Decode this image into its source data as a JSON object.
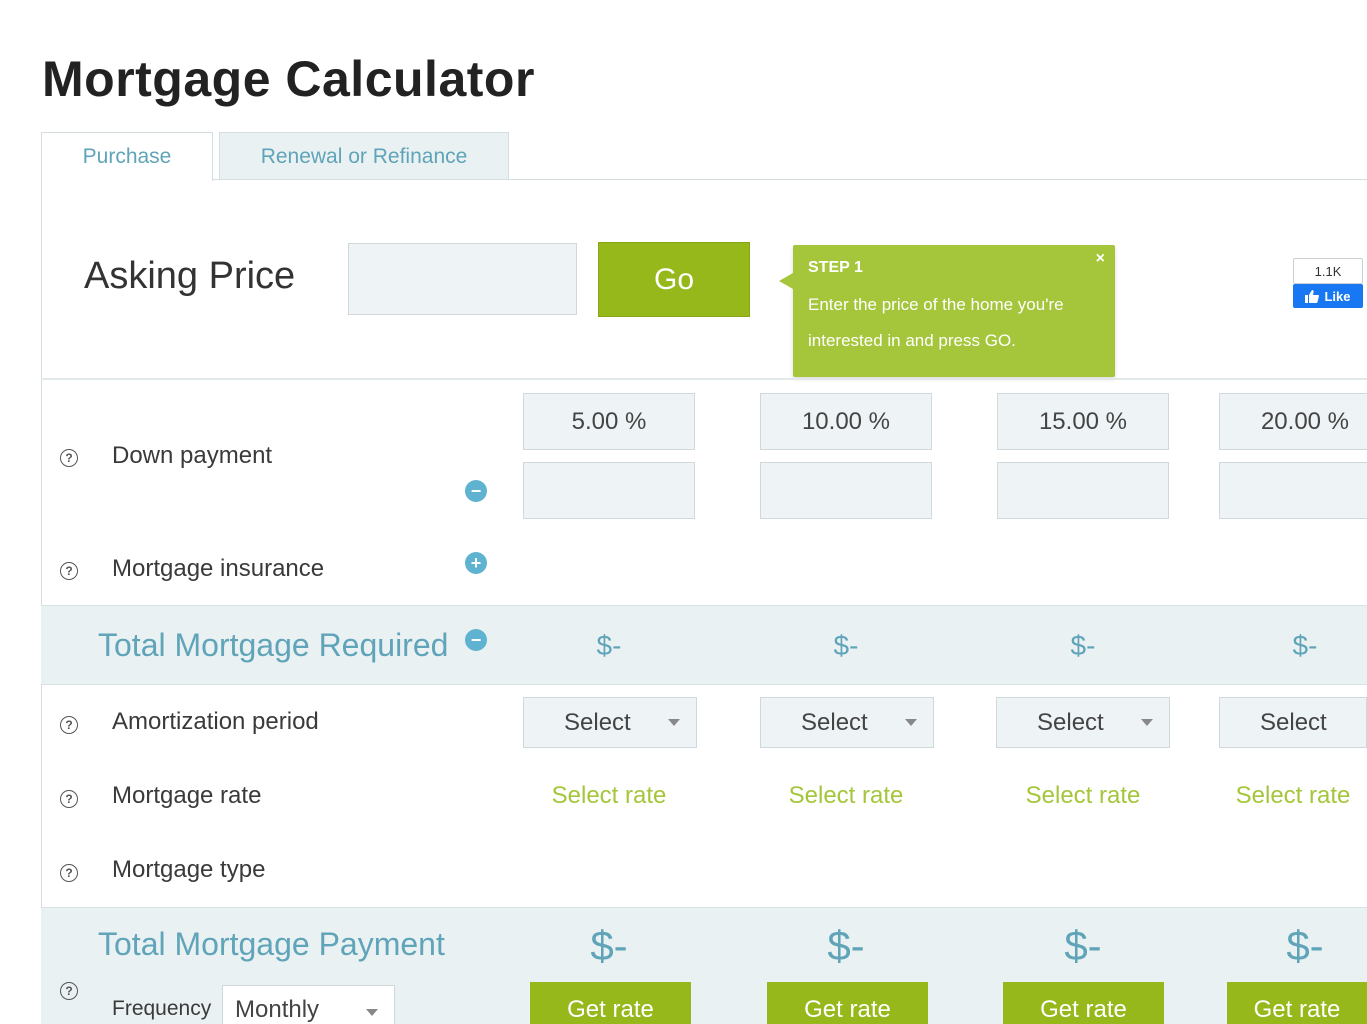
{
  "page": {
    "title": "Mortgage Calculator"
  },
  "tabs": [
    {
      "label": "Purchase",
      "active": true
    },
    {
      "label": "Renewal or Refinance",
      "active": false
    }
  ],
  "asking_price": {
    "label": "Asking Price",
    "value": "",
    "go_label": "Go"
  },
  "tooltip": {
    "title": "STEP 1",
    "text": "Enter the price of the home you're interested in and press GO.",
    "close": "×"
  },
  "facebook": {
    "count": "1.1K",
    "like_label": "Like"
  },
  "help_glyph": "?",
  "rows": {
    "down_payment": "Down payment",
    "mortgage_insurance": "Mortgage insurance",
    "amortization": "Amortization period",
    "mortgage_rate": "Mortgage rate",
    "mortgage_type": "Mortgage type"
  },
  "buttons": {
    "minus": "−",
    "plus": "+"
  },
  "down_payment_percents": [
    "5.00 %",
    "10.00 %",
    "15.00 %",
    "20.00 %"
  ],
  "total_required": {
    "title": "Total Mortgage Required",
    "values": [
      "$-",
      "$-",
      "$-",
      "$-"
    ]
  },
  "amortization_selects": [
    "Select",
    "Select",
    "Select",
    "Select"
  ],
  "rate_links": [
    "Select rate",
    "Select rate",
    "Select rate",
    "Select rate"
  ],
  "total_payment": {
    "title": "Total Mortgage Payment",
    "values": [
      "$-",
      "$-",
      "$-",
      "$-"
    ],
    "frequency_label": "Frequency",
    "frequency_value": "Monthly",
    "get_rate_labels": [
      "Get rate",
      "Get rate",
      "Get rate",
      "Get rate"
    ]
  },
  "colors": {
    "accent_green": "#96b81a",
    "teal": "#5fa4b8",
    "band_bg": "#eaf1f3"
  }
}
